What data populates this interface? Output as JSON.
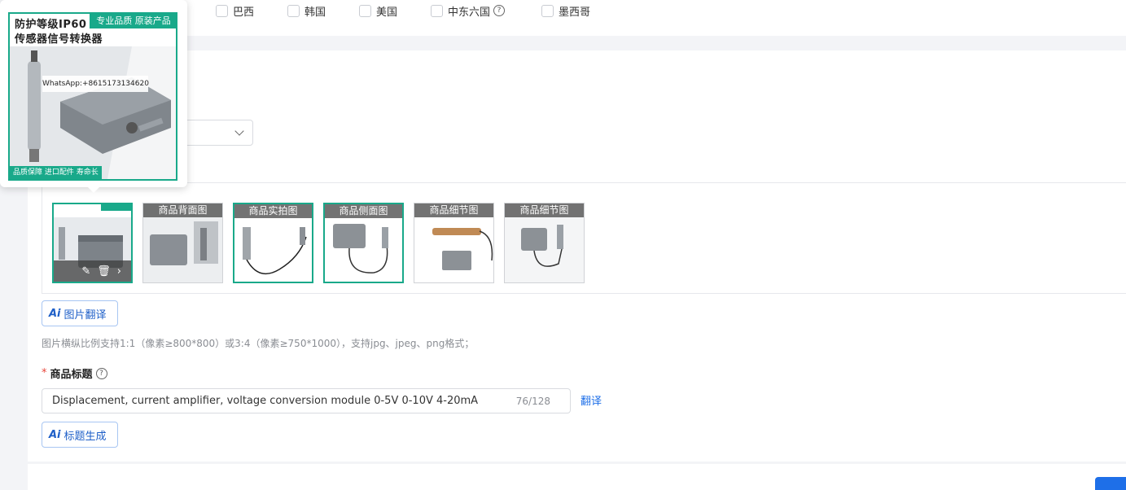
{
  "countries": [
    {
      "label": "巴西"
    },
    {
      "label": "韩国"
    },
    {
      "label": "美国"
    },
    {
      "label": "中东六国",
      "help": "?"
    },
    {
      "label": "墨西哥"
    }
  ],
  "preview": {
    "title_line1": "防护等级IP60",
    "title_line2": "传感器信号转换器",
    "tag": "专业品质 原装产品",
    "whatsapp": "WhatsApp:+8615173134620",
    "footer": "品质保障 进口配件 寿命长"
  },
  "thumbnails": [
    {
      "label": ""
    },
    {
      "label": "商品背面图"
    },
    {
      "label": "商品实拍图"
    },
    {
      "label": "商品侧面图"
    },
    {
      "label": "商品细节图"
    },
    {
      "label": "商品细节图"
    }
  ],
  "image_translate_btn": "图片翻译",
  "image_hint": "图片横纵比例支持1:1（像素≥800*800）或3:4（像素≥750*1000），支持jpg、jpeg、png格式；",
  "title_field": {
    "required_mark": "*",
    "label": "商品标题",
    "value": "Displacement, current amplifier, voltage conversion module 0-5V 0-10V 4-20mA",
    "count": "76/128",
    "translate": "翻译"
  },
  "title_generate_btn": "标题生成",
  "ai_mark": "Ai",
  "colors": {
    "accent": "#1e6fe8",
    "green": "#19a98a"
  }
}
